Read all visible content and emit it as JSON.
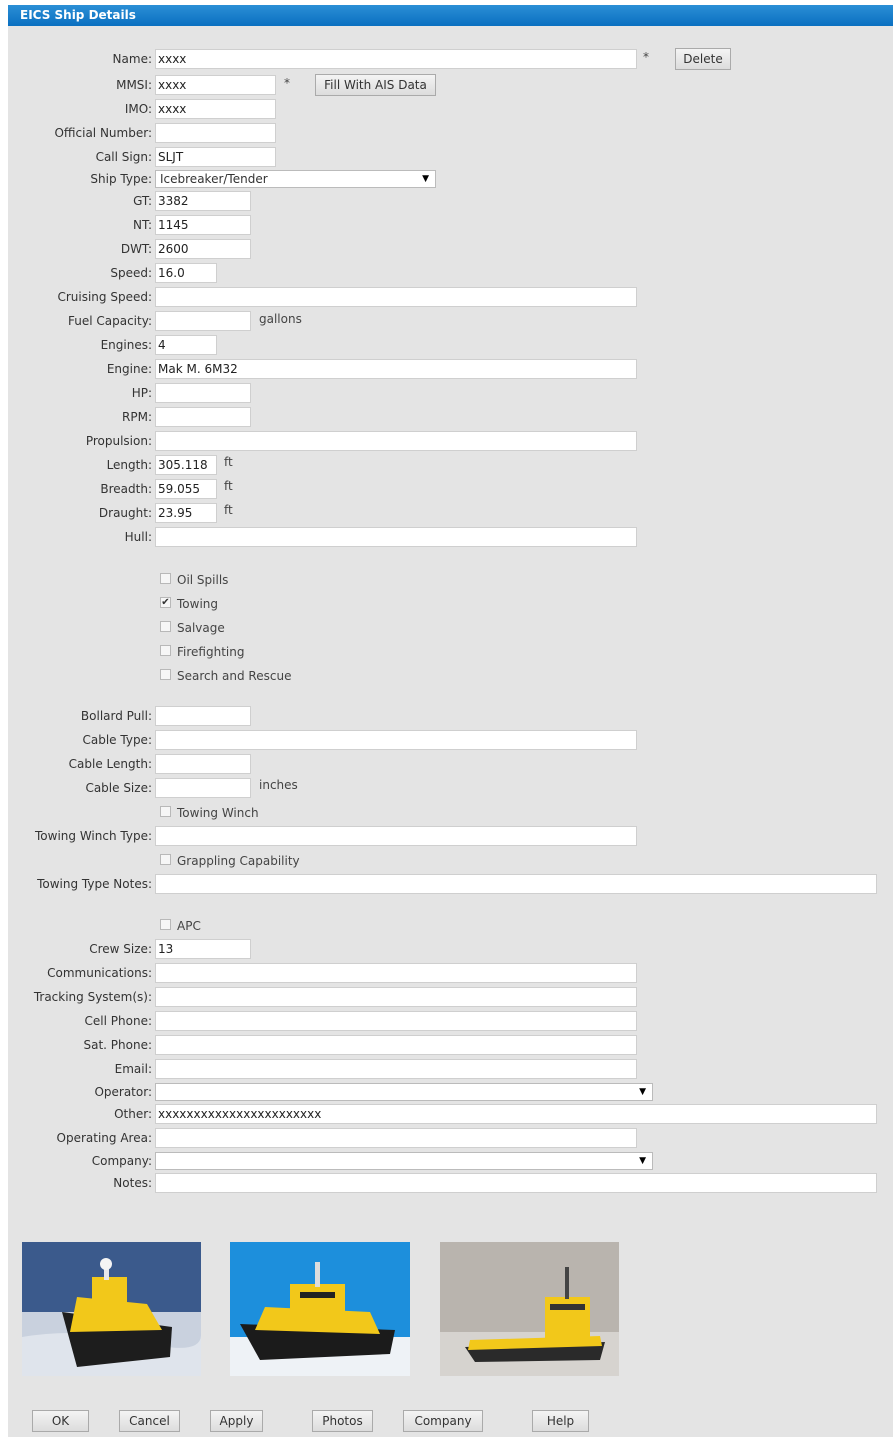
{
  "window": {
    "title": "EICS Ship Details"
  },
  "fields": {
    "name": {
      "label": "Name:",
      "value": "xxxx",
      "required": "*"
    },
    "mmsi": {
      "label": "MMSI:",
      "value": "xxxx",
      "required": "*"
    },
    "imo": {
      "label": "IMO:",
      "value": "xxxx"
    },
    "official_number": {
      "label": "Official Number:",
      "value": ""
    },
    "call_sign": {
      "label": "Call Sign:",
      "value": "SLJT"
    },
    "ship_type": {
      "label": "Ship Type:",
      "value": "Icebreaker/Tender"
    },
    "gt": {
      "label": "GT:",
      "value": "3382"
    },
    "nt": {
      "label": "NT:",
      "value": "1145"
    },
    "dwt": {
      "label": "DWT:",
      "value": "2600"
    },
    "speed": {
      "label": "Speed:",
      "value": "16.0"
    },
    "cruising_speed": {
      "label": "Cruising Speed:",
      "value": ""
    },
    "fuel_capacity": {
      "label": "Fuel Capacity:",
      "value": "",
      "unit": "gallons"
    },
    "engines": {
      "label": "Engines:",
      "value": "4"
    },
    "engine": {
      "label": "Engine:",
      "value": "Mak M. 6M32"
    },
    "hp": {
      "label": "HP:",
      "value": ""
    },
    "rpm": {
      "label": "RPM:",
      "value": ""
    },
    "propulsion": {
      "label": "Propulsion:",
      "value": ""
    },
    "length": {
      "label": "Length:",
      "value": "305.118",
      "unit": "ft"
    },
    "breadth": {
      "label": "Breadth:",
      "value": "59.055",
      "unit": "ft"
    },
    "draught": {
      "label": "Draught:",
      "value": "23.95",
      "unit": "ft"
    },
    "hull": {
      "label": "Hull:",
      "value": ""
    },
    "bollard_pull": {
      "label": "Bollard Pull:",
      "value": ""
    },
    "cable_type": {
      "label": "Cable Type:",
      "value": ""
    },
    "cable_length": {
      "label": "Cable Length:",
      "value": ""
    },
    "cable_size": {
      "label": "Cable Size:",
      "value": "",
      "unit": "inches"
    },
    "towing_winch_type": {
      "label": "Towing Winch Type:",
      "value": ""
    },
    "towing_type_notes": {
      "label": "Towing Type Notes:",
      "value": ""
    },
    "crew_size": {
      "label": "Crew Size:",
      "value": "13"
    },
    "communications": {
      "label": "Communications:",
      "value": ""
    },
    "tracking_systems": {
      "label": "Tracking System(s):",
      "value": ""
    },
    "cell_phone": {
      "label": "Cell Phone:",
      "value": ""
    },
    "sat_phone": {
      "label": "Sat. Phone:",
      "value": ""
    },
    "email": {
      "label": "Email:",
      "value": ""
    },
    "operator": {
      "label": "Operator:",
      "value": ""
    },
    "other": {
      "label": "Other:",
      "value": "xxxxxxxxxxxxxxxxxxxxxxx"
    },
    "operating_area": {
      "label": "Operating Area:",
      "value": ""
    },
    "company": {
      "label": "Company:",
      "value": ""
    },
    "notes": {
      "label": "Notes:",
      "value": ""
    }
  },
  "capabilities": [
    {
      "label": "Oil Spills",
      "checked": false
    },
    {
      "label": "Towing",
      "checked": true
    },
    {
      "label": "Salvage",
      "checked": false
    },
    {
      "label": "Firefighting",
      "checked": false
    },
    {
      "label": "Search and Rescue",
      "checked": false
    }
  ],
  "towing_winch": {
    "label": "Towing Winch",
    "checked": false
  },
  "grappling": {
    "label": "Grappling Capability",
    "checked": false
  },
  "apc": {
    "label": "APC",
    "checked": false
  },
  "buttons": {
    "delete": "Delete",
    "fill_ais": "Fill With AIS Data",
    "ok": "OK",
    "cancel": "Cancel",
    "apply": "Apply",
    "photos": "Photos",
    "company": "Company",
    "help": "Help"
  },
  "icons": {
    "checkmark": "✔",
    "dropdown": "▼"
  },
  "colors": {
    "title_bar": "#0a6fc0",
    "window_bg": "#e4e4e4",
    "hull_yellow": "#f2c81a"
  }
}
